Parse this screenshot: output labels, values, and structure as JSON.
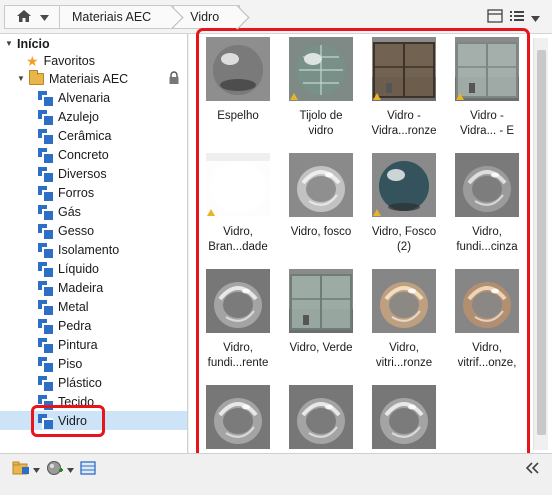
{
  "breadcrumb": {
    "items": [
      {
        "label": "Materiais AEC"
      },
      {
        "label": "Vidro"
      }
    ]
  },
  "tree": {
    "root": {
      "label": "Início"
    },
    "favorites": {
      "label": "Favoritos"
    },
    "library": {
      "label": "Materiais AEC",
      "locked": true
    },
    "categories": [
      {
        "label": "Alvenaria"
      },
      {
        "label": "Azulejo"
      },
      {
        "label": "Cerâmica"
      },
      {
        "label": "Concreto"
      },
      {
        "label": "Diversos"
      },
      {
        "label": "Forros"
      },
      {
        "label": "Gás"
      },
      {
        "label": "Gesso"
      },
      {
        "label": "Isolamento"
      },
      {
        "label": "Líquido"
      },
      {
        "label": "Madeira"
      },
      {
        "label": "Metal"
      },
      {
        "label": "Pedra"
      },
      {
        "label": "Pintura"
      },
      {
        "label": "Piso"
      },
      {
        "label": "Plástico"
      },
      {
        "label": "Tecido"
      },
      {
        "label": "Vidro",
        "selected": true
      }
    ]
  },
  "materials": [
    {
      "line1": "Espelho",
      "line2": "",
      "thumb": "mirror-sphere",
      "warn": false
    },
    {
      "line1": "Tijolo de",
      "line2": "vidro",
      "thumb": "glass-block-sphere",
      "warn": true
    },
    {
      "line1": "Vidro -",
      "line2": "Vidra...ronze",
      "thumb": "bronze-glazing-panel",
      "warn": true
    },
    {
      "line1": "Vidro -",
      "line2": "Vidra... - E",
      "thumb": "clear-glazing-panel",
      "warn": true
    },
    {
      "line1": "Vidro,",
      "line2": "Bran...dade",
      "thumb": "white-glass",
      "warn": true
    },
    {
      "line1": "Vidro, fosco",
      "line2": "",
      "thumb": "frosted-glass",
      "warn": false
    },
    {
      "line1": "Vidro, Fosco",
      "line2": "(2)",
      "thumb": "dark-teal-sphere",
      "warn": true
    },
    {
      "line1": "Vidro,",
      "line2": "fundi...cinza",
      "thumb": "cast-glass-gray",
      "warn": false
    },
    {
      "line1": "Vidro,",
      "line2": "fundi...rente",
      "thumb": "cast-glass-clear",
      "warn": false
    },
    {
      "line1": "Vidro, Verde",
      "line2": "",
      "thumb": "green-glazing-panel",
      "warn": false
    },
    {
      "line1": "Vidro,",
      "line2": "vitri...ronze",
      "thumb": "stained-bronze",
      "warn": false
    },
    {
      "line1": "Vidro,",
      "line2": "vitrif...onze,",
      "thumb": "stained-bronze-2",
      "warn": false
    },
    {
      "line1": "",
      "line2": "",
      "thumb": "cast-glass-clear",
      "warn": false
    },
    {
      "line1": "",
      "line2": "",
      "thumb": "cast-glass-clear",
      "warn": false
    },
    {
      "line1": "",
      "line2": "",
      "thumb": "cast-glass-clear",
      "warn": false
    }
  ],
  "colors": {
    "highlight": "#e8141b",
    "selection": "#cde3f7",
    "library_icon": "#2d6fc6"
  }
}
